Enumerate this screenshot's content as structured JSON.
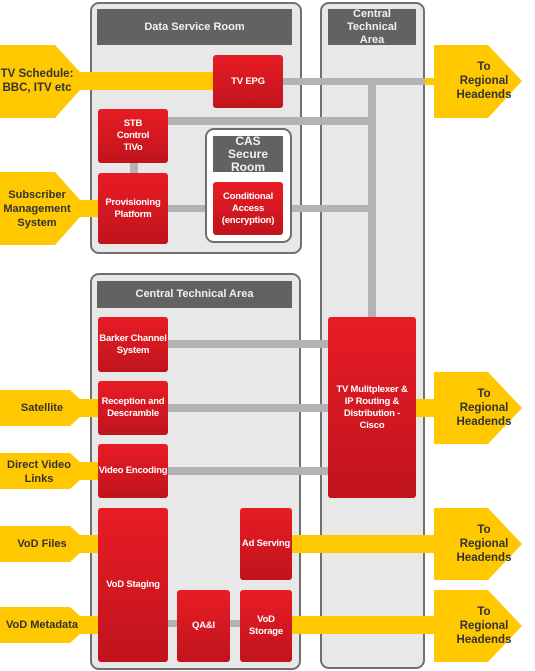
{
  "colors": {
    "arrow": "#FFC800",
    "box": "#E01A22",
    "header": "#626263",
    "room": "#E8E8E8",
    "connector": "#B3B3B3"
  },
  "rooms": {
    "data_service": "Data Service Room",
    "central_right": "Central Technical Area",
    "cas": "CAS Secure Room",
    "central_bottom": "Central Technical Area"
  },
  "boxes": {
    "tv_epg": "TV EPG",
    "stb": "STB Control TiVo",
    "provisioning": "Provisioning Platform",
    "conditional_access": "Conditional Access (encryption)",
    "barker": "Barker Channel System",
    "reception": "Reception and Descramble",
    "video_encoding": "Video Encoding",
    "vod_staging": "VoD Staging",
    "ad_serving": "Ad Serving",
    "qai": "QA&I",
    "vod_storage": "VoD Storage",
    "multiplexer": "TV Mulitplexer & IP Routing & Distribution - Cisco"
  },
  "inputs": {
    "tv_schedule": "TV Schedule: BBC, ITV etc",
    "subscriber": "Subscriber Management System",
    "satellite": "Satellite",
    "direct_video": "Direct Video Links",
    "vod_files": "VoD Files",
    "vod_metadata": "VoD Metadata"
  },
  "outputs": [
    "To Regional Headends",
    "To Regional Headends",
    "To Regional Headends",
    "To Regional Headends"
  ]
}
